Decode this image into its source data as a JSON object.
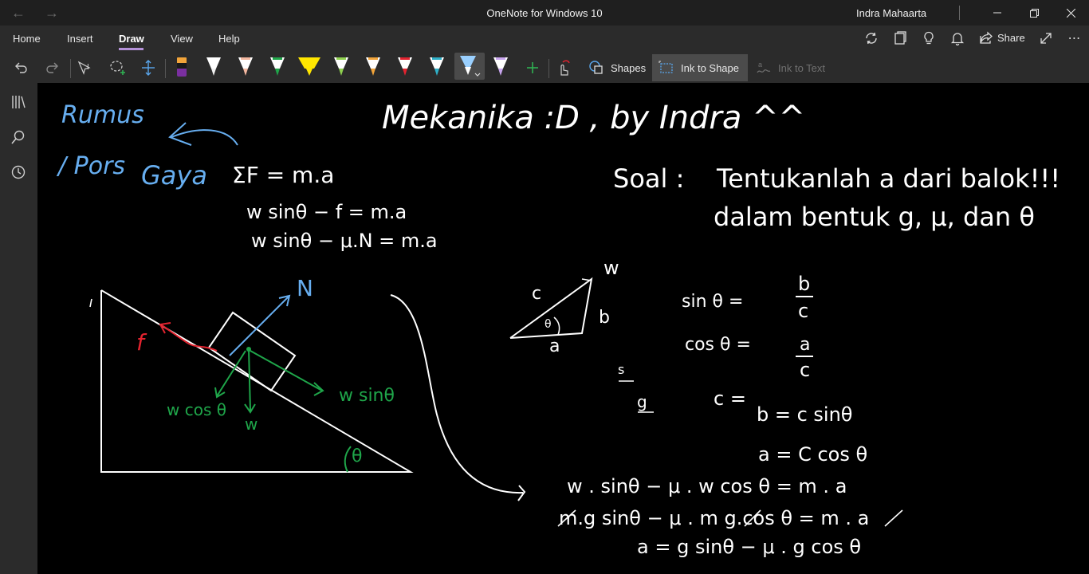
{
  "window": {
    "title": "OneNote for Windows 10",
    "user": "Indra Mahaarta"
  },
  "tabs": [
    {
      "label": "Home"
    },
    {
      "label": "Insert"
    },
    {
      "label": "Draw"
    },
    {
      "label": "View"
    },
    {
      "label": "Help"
    }
  ],
  "active_tab": "Draw",
  "share_label": "Share",
  "toolbar": {
    "shapes_label": "Shapes",
    "ink_to_shape_label": "Ink to Shape",
    "ink_to_text_label": "Ink to Text"
  },
  "pens": [
    {
      "name": "pen-purple",
      "color": "#7a2fa0"
    },
    {
      "name": "pen-white",
      "color": "#ffffff"
    },
    {
      "name": "pen-peach",
      "color": "#f4b8a0"
    },
    {
      "name": "pen-green",
      "color": "#1fa64a"
    },
    {
      "name": "highlighter-yellow",
      "color": "#ffe600"
    },
    {
      "name": "pen-light-green",
      "color": "#8fd14f"
    },
    {
      "name": "pen-orange",
      "color": "#f2a43a"
    },
    {
      "name": "pen-red",
      "color": "#e3232f"
    },
    {
      "name": "pen-teal",
      "color": "#2fb0c8"
    },
    {
      "name": "pen-light-blue",
      "color": "#67aef0"
    },
    {
      "name": "pen-lavender",
      "color": "#c9a6f0"
    }
  ],
  "canvas": {
    "title": "Mekanika :D , by Indra ^^",
    "rumus": "Rumus",
    "pors": "/ Pors",
    "gaya": "Gaya",
    "eq1": "ΣF = m.a",
    "eq2": "w sinθ − f = m.a",
    "eq3": "w sinθ − μ.N = m.a",
    "soal_label": "Soal :",
    "soal_line1": "Tentukanlah a dari balok!!!",
    "soal_line2": "dalam bentuk g, μ, dan θ",
    "label_N": "N",
    "label_f": "f",
    "label_wcos": "w cos θ",
    "label_w": "w",
    "label_wsin": "w sinθ",
    "label_theta": "θ",
    "tri_c": "c",
    "tri_b": "b",
    "tri_a": "a",
    "tri_w": "w",
    "tri_theta": "θ",
    "sin_lhs": "sin θ =",
    "sin_num": "b",
    "sin_den": "c",
    "cos_lhs": "cos θ =",
    "cos_num": "a",
    "cos_den": "c",
    "c_eq": "c =",
    "b_eq": "b = c sinθ",
    "a_eq": "a = C cos θ",
    "s_small": "s",
    "g_small": "g",
    "final1": "w . sinθ − μ . w cos θ = m . a",
    "final2": "m.g sinθ − μ . m g.cos θ = m . a",
    "final3": "a = g sinθ − μ . g cos θ"
  }
}
